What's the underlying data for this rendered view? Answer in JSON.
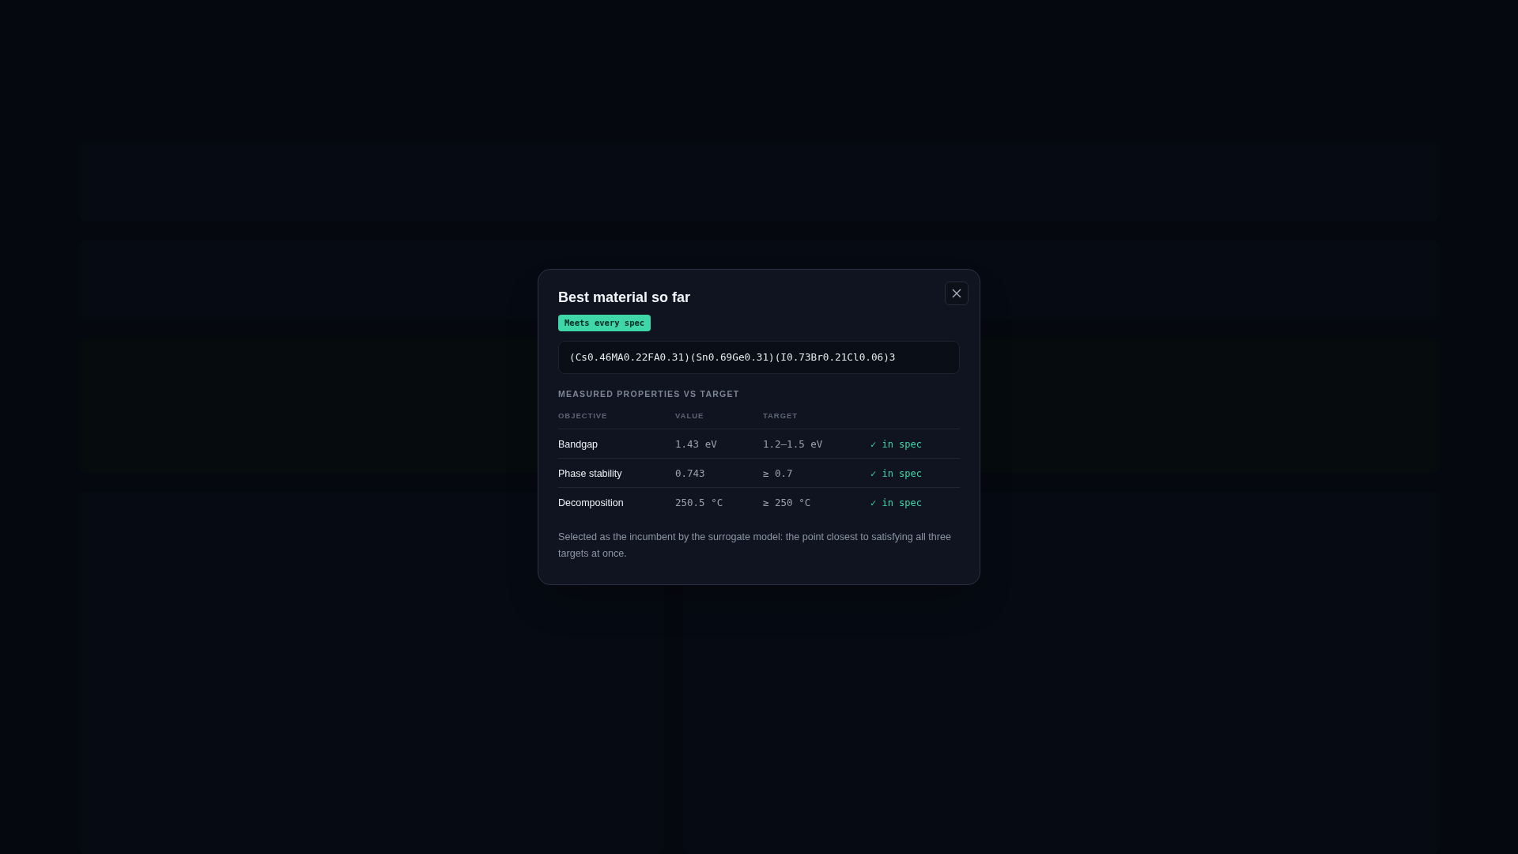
{
  "dialog": {
    "title": "Best material so far",
    "badge": "Meets every spec",
    "formula": "(Cs0.46MA0.22FA0.31)(Sn0.69Ge0.31)(I0.73Br0.21Cl0.06)3",
    "section_title": "MEASURED PROPERTIES VS TARGET",
    "table": {
      "columns": [
        "OBJECTIVE",
        "VALUE",
        "TARGET"
      ],
      "rows": [
        {
          "objective": "Bandgap",
          "value": "1.43 eV",
          "target": "1.2–1.5 eV",
          "status": "✓ in spec",
          "in_spec": true
        },
        {
          "objective": "Phase stability",
          "value": "0.743",
          "target": "≥ 0.7",
          "status": "✓ in spec",
          "in_spec": true
        },
        {
          "objective": "Decomposition",
          "value": "250.5 °C",
          "target": "≥ 250 °C",
          "status": "✓ in spec",
          "in_spec": true
        }
      ]
    },
    "note": "Selected as the incumbent by the surrogate model: the point closest to satisfying all three targets at once."
  }
}
